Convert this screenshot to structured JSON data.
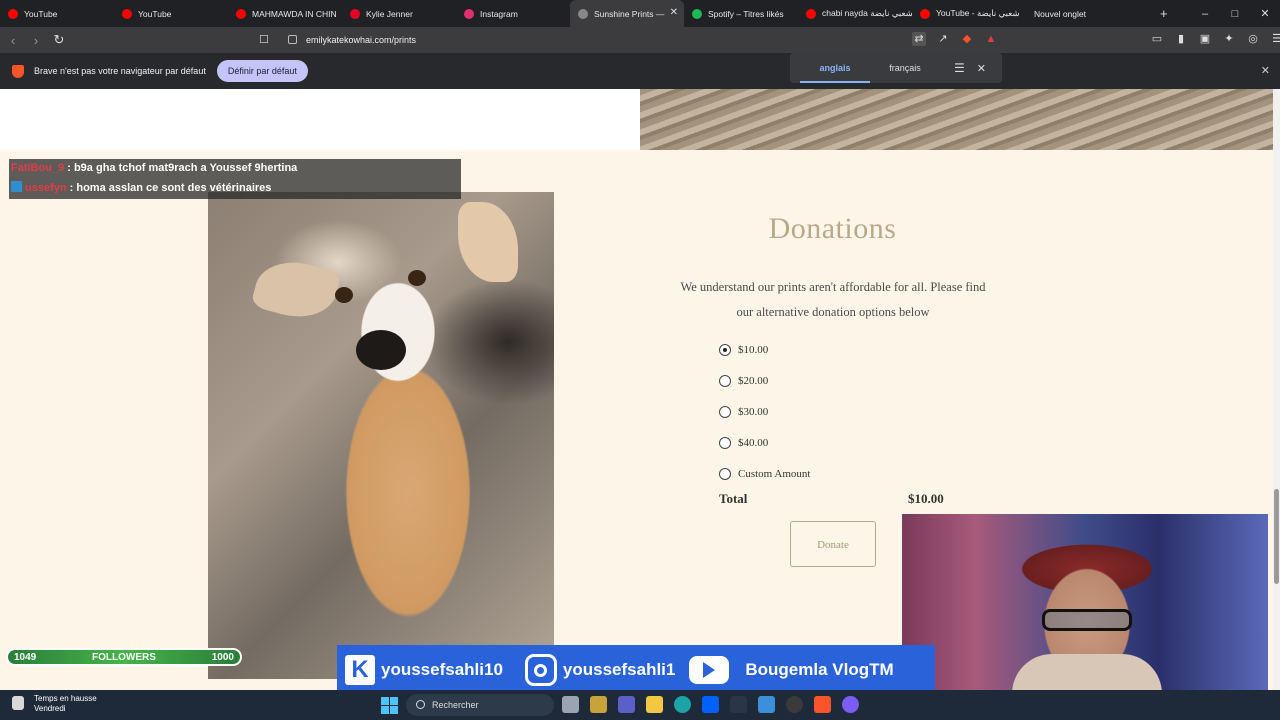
{
  "browser": {
    "tabs": [
      {
        "label": "YouTube",
        "icon": "youtube-icon",
        "color": "#ff0000"
      },
      {
        "label": "YouTube",
        "icon": "youtube-icon",
        "color": "#ff0000"
      },
      {
        "label": "MAHMAWDA IN CHIN",
        "icon": "youtube-icon",
        "color": "#ff0000"
      },
      {
        "label": "Kylie Jenner",
        "icon": "pinterest-icon",
        "color": "#e60023"
      },
      {
        "label": "Instagram",
        "icon": "instagram-icon",
        "color": "#e1306c"
      },
      {
        "label": "Sunshine Prints —",
        "icon": "site-icon",
        "color": "#888888",
        "active": true
      },
      {
        "label": "Spotify – Titres likés",
        "icon": "spotify-icon",
        "color": "#1db954"
      },
      {
        "label": "chabi nayda شعبي نايضة",
        "icon": "youtube-icon",
        "color": "#ff0000"
      },
      {
        "label": "YouTube - شعبي نايضة",
        "icon": "youtube-icon",
        "color": "#ff0000"
      },
      {
        "label": "Nouvel onglet",
        "icon": "",
        "color": ""
      }
    ],
    "url": "emilykatekowhai.com/prints",
    "infobar_message": "Brave n'est pas votre navigateur par défaut",
    "set_default_label": "Définir par défaut",
    "translate": {
      "from": "anglais",
      "to": "français"
    }
  },
  "chat": [
    {
      "user": "FatiBou_9",
      "text": " : b9a gha tchof mat9rach a Youssef 9hertina"
    },
    {
      "user": "ussefyn",
      "text": " : homa asslan ce sont des vétérinaires"
    }
  ],
  "donations": {
    "title": "Donations",
    "description": "We understand our prints aren't affordable for all. Please find our alternative donation options below",
    "options": [
      "$10.00",
      "$20.00",
      "$30.00",
      "$40.00",
      "Custom Amount"
    ],
    "selected_index": 0,
    "total_label": "Total",
    "total_value": "$10.00",
    "donate_label": "Donate"
  },
  "overlay": {
    "followers_current": "1049",
    "followers_label": "FOLLOWERS",
    "followers_goal": "1000",
    "kick_handle": "youssefsahli10",
    "instagram_handle": "youssefsahli1",
    "youtube_handle": "Bougemla VlogTM"
  },
  "taskbar": {
    "weather_title": "Temps en hausse",
    "weather_sub": "Vendredi",
    "search_placeholder": "Rechercher"
  }
}
